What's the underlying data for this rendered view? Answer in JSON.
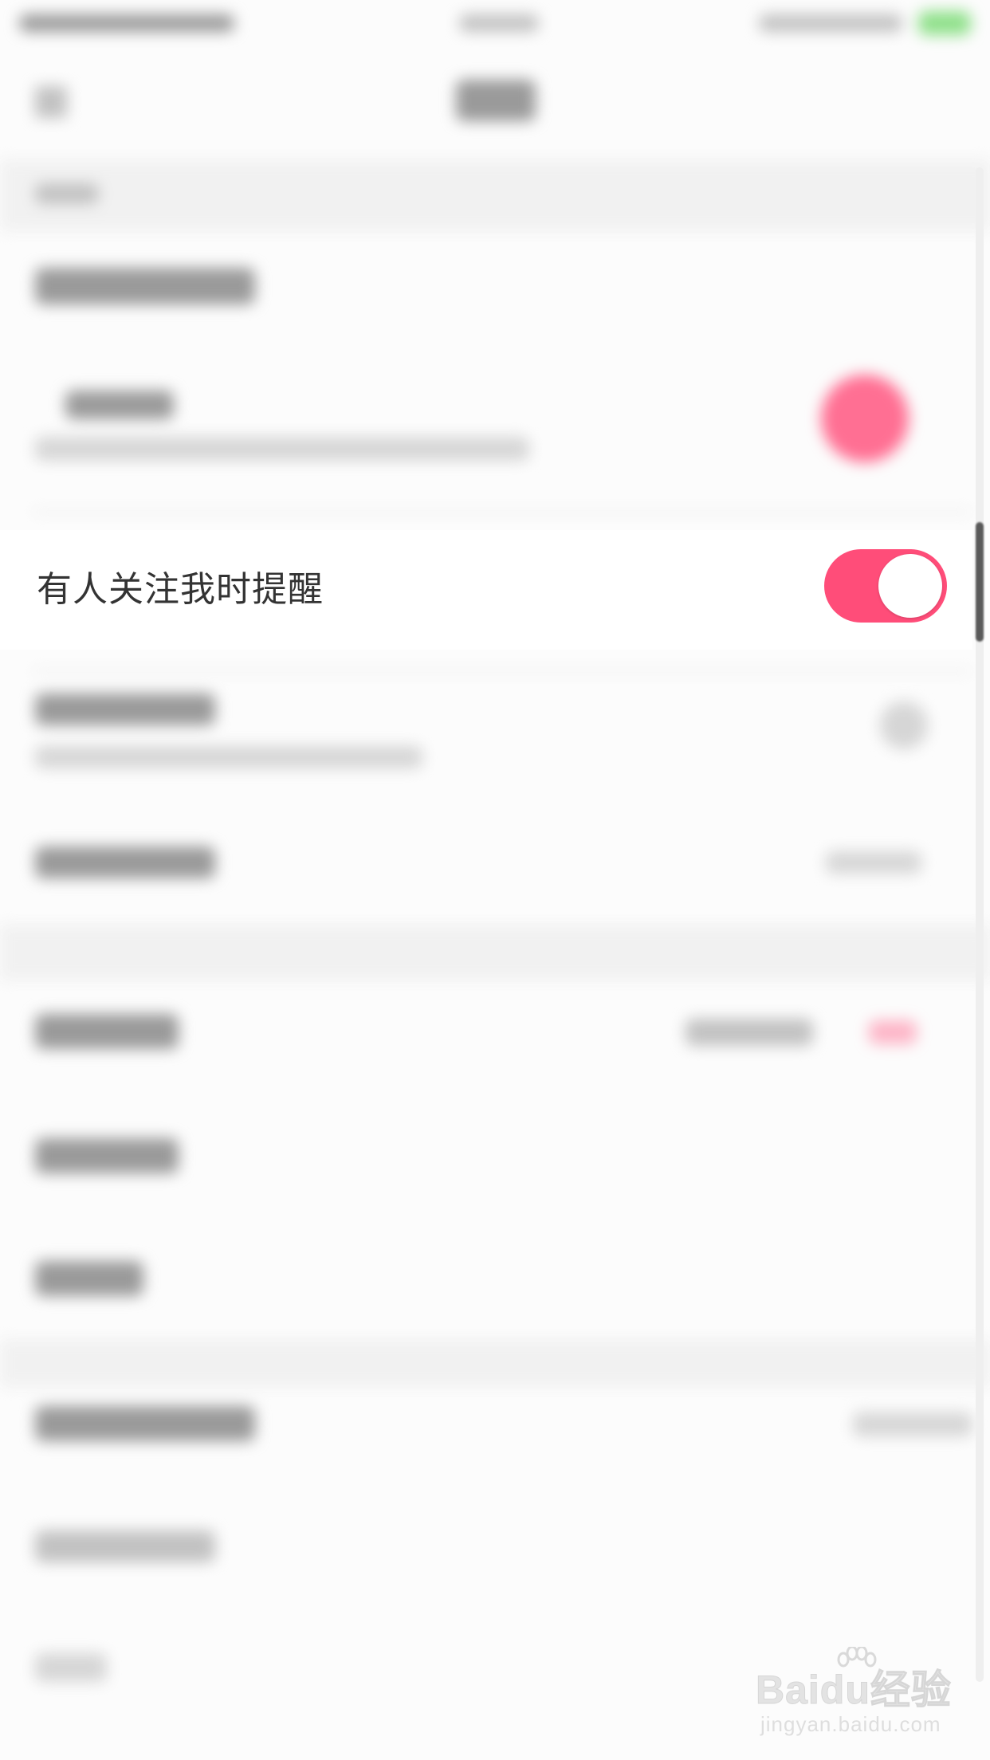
{
  "settings": {
    "follow_notification": {
      "label": "有人关注我时提醒",
      "enabled": true
    }
  },
  "colors": {
    "accent": "#ff4d79",
    "toggle_knob": "#ffffff",
    "label_text": "#333333",
    "background": "#fcfcfc"
  },
  "watermark": {
    "brand": "Baidu经验",
    "url": "jingyan.baidu.com",
    "icon": "paw-icon"
  }
}
